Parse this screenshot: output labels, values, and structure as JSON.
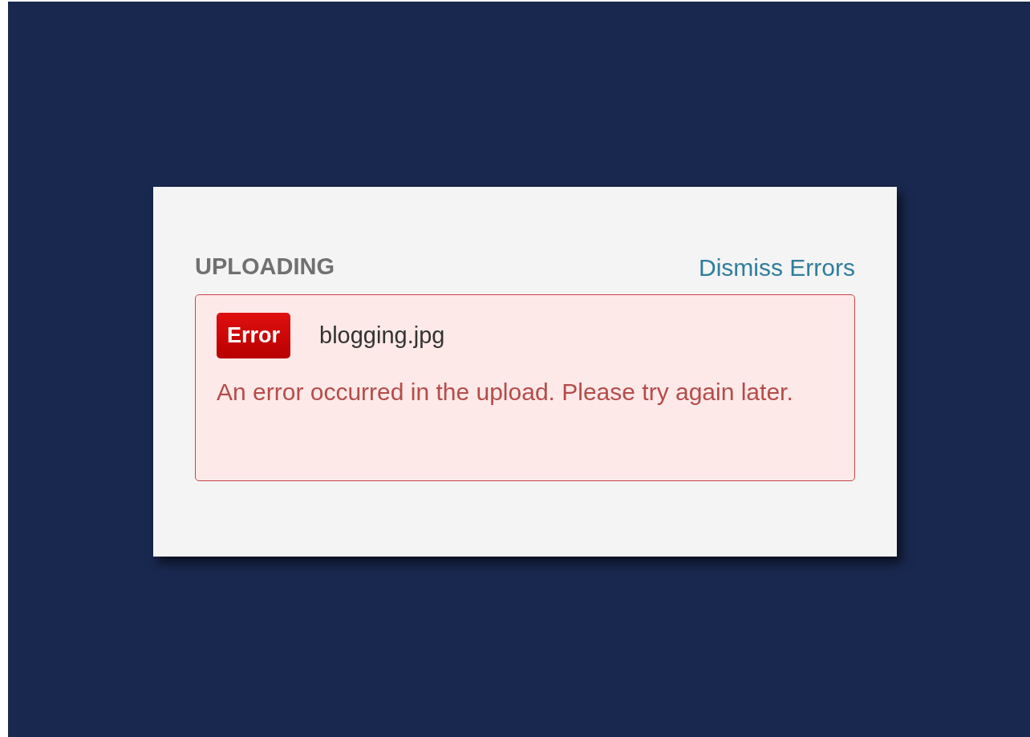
{
  "panel": {
    "title": "UPLOADING",
    "dismiss_link": "Dismiss Errors"
  },
  "errors": [
    {
      "badge": "Error",
      "filename": "blogging.jpg",
      "message": "An error occurred in the upload. Please try again later."
    }
  ]
}
